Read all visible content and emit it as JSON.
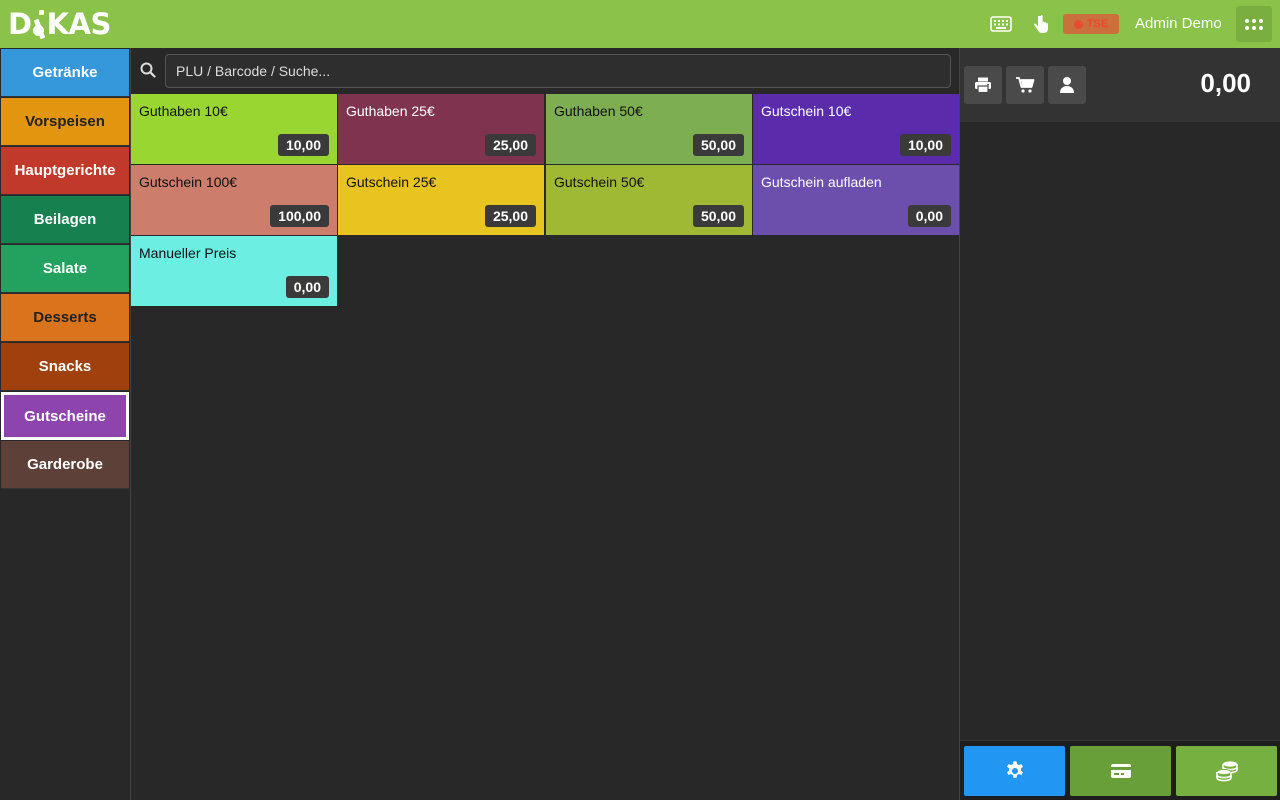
{
  "header": {
    "logo_text": "DIKAS",
    "tse_label": "TSE",
    "user": "Admin Demo"
  },
  "search": {
    "placeholder": "PLU / Barcode / Suche..."
  },
  "categories": [
    {
      "label": "Getränke",
      "color": "#3498db"
    },
    {
      "label": "Vorspeisen",
      "color": "#e2950f"
    },
    {
      "label": "Hauptgerichte",
      "color": "#c0392b"
    },
    {
      "label": "Beilagen",
      "color": "#16814f"
    },
    {
      "label": "Salate",
      "color": "#22a15f"
    },
    {
      "label": "Desserts",
      "color": "#d9731c"
    },
    {
      "label": "Snacks",
      "color": "#a0410d"
    },
    {
      "label": "Gutscheine",
      "color": "#8e44ad",
      "active": true
    },
    {
      "label": "Garderobe",
      "color": "#5d4037"
    }
  ],
  "products": [
    {
      "name": "Guthaben 10€",
      "price": "10,00",
      "color": "#9ad632"
    },
    {
      "name": "Guthaben 25€",
      "price": "25,00",
      "color": "#80334f"
    },
    {
      "name": "Guthaben 50€",
      "price": "50,00",
      "color": "#7dae52"
    },
    {
      "name": "Gutschein 10€",
      "price": "10,00",
      "color": "#5a2bab"
    },
    {
      "name": "Gutschein 100€",
      "price": "100,00",
      "color": "#cc7d6c"
    },
    {
      "name": "Gutschein 25€",
      "price": "25,00",
      "color": "#e7c41f"
    },
    {
      "name": "Gutschein 50€",
      "price": "50,00",
      "color": "#a0b934"
    },
    {
      "name": "Gutschein aufladen",
      "price": "0,00",
      "color": "#6c4ead"
    },
    {
      "name": "Manueller Preis",
      "price": "0,00",
      "color": "#6ceee3"
    }
  ],
  "cart": {
    "total": "0,00"
  },
  "colors": {
    "topbar": "#8bc34a",
    "settings_button": "#2196f3",
    "card_button": "#689f38",
    "cash_button": "#76b041"
  },
  "icons": [
    "keyboard-icon",
    "touch-icon",
    "apps-icon",
    "search-icon",
    "printer-icon",
    "cart-icon",
    "user-icon",
    "gear-icon",
    "credit-card-icon",
    "coins-icon"
  ]
}
